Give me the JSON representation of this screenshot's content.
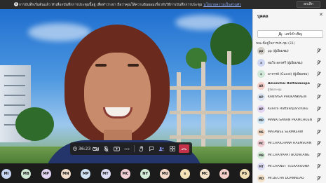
{
  "banner": {
    "message": "การบันทึกเริ่มต้นแล้ว ทำเลือกบันทึกการประชุมนี้อยู่ เพื่อทำว่าเขา ถือว่าคุณให้ความยินยอมเกี่ยวกับวิธีการบันทึกการประชุม",
    "link_text": "นโยบายความเป็นส่วนตัว",
    "dismiss_label": "ยกเลิก"
  },
  "toolbar": {
    "time": "36:23"
  },
  "panel": {
    "title": "บุคคล",
    "invite_label": "แชร์คำเชิญ",
    "section_label": "ขณะนี้อยู่ในการประชุม (31)",
    "participants": [
      {
        "initials": "pp",
        "name": "pp (ผู้เยี่ยมชม)",
        "color": "#d3cfc9"
      },
      {
        "initials": "ส",
        "name": "สมใจ ลลาศรี (ผู้เยี่ยมชม)",
        "color": "#cfd7f5"
      },
      {
        "initials": "อ",
        "name": "อาจารย์ (Guest) (ผู้เยี่ยมชม)",
        "color": "#cfe8d7"
      },
      {
        "initials": "AR",
        "name": "Amonchai Rattanasopa",
        "role": "ผู้จัดประชุม",
        "color": "#f5cfc9"
      },
      {
        "initials": "KP",
        "name": "KANYASA PHUKANKAEW",
        "color": "#d9e3f1"
      },
      {
        "initials": "KP",
        "name": "Kulisra Hattakitpanchaku",
        "color": "#e4d6f2"
      },
      {
        "initials": "MP",
        "name": "MANATSANAN PRAMCHUEN",
        "color": "#cfe6f5"
      },
      {
        "initials": "MS",
        "name": "MATAWEE SERMKEAW",
        "color": "#f4dcc8"
      },
      {
        "initials": "MC",
        "name": "Mr.CHAICHANA HAEMSUAN",
        "color": "#f3cfd6"
      },
      {
        "initials": "MB",
        "name": "Mr.CHAIYAPAT BOONTANG",
        "color": "#d3ecd8"
      },
      {
        "initials": "MT",
        "name": "Mr.CHANUT TEERAROUNA",
        "color": "#dcdcf5"
      },
      {
        "initials": "MD",
        "name": "Mr.DECHA DUANNGAO",
        "color": "#f5e3c9"
      }
    ]
  },
  "strip": {
    "chips": [
      {
        "initials": "MI",
        "color": "#c7d5f3"
      },
      {
        "initials": "MB",
        "color": "#cde7d3"
      },
      {
        "initials": "MP",
        "color": "#e2d3f2"
      },
      {
        "initials": "MN",
        "color": "#f0dcc8"
      },
      {
        "initials": "MP",
        "color": "#cfe3f5"
      },
      {
        "initials": "MT",
        "color": "#dcdcf5"
      },
      {
        "initials": "MC",
        "color": "#f3cfd6"
      },
      {
        "initials": "NY",
        "color": "#d3ecd8"
      },
      {
        "initials": "MU",
        "color": "#f5d9c9"
      },
      {
        "initials": "s",
        "color": "#f3e2b8"
      },
      {
        "initials": "MC",
        "color": "#f5e3c9"
      },
      {
        "initials": "AR",
        "color": "#f5cfc9"
      },
      {
        "initials": "PS",
        "color": "#f1e0b5"
      }
    ]
  }
}
